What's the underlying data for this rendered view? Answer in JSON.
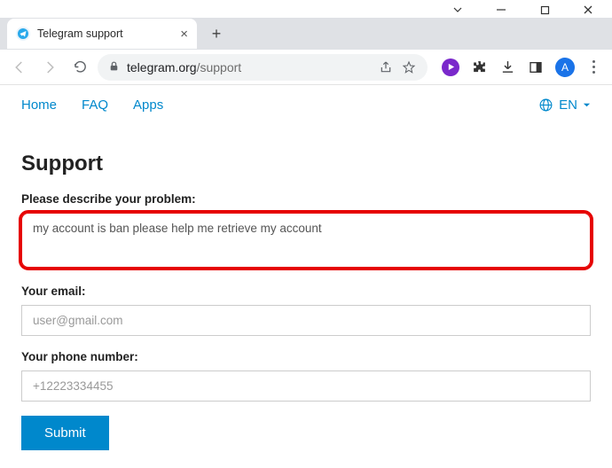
{
  "browser": {
    "tab_title": "Telegram support",
    "url_host": "telegram.org",
    "url_path": "/support",
    "avatar_letter": "A"
  },
  "nav": {
    "home": "Home",
    "faq": "FAQ",
    "apps": "Apps",
    "lang": "EN"
  },
  "page_title": "Support",
  "form": {
    "problem_label": "Please describe your problem:",
    "problem_value": "my account is ban please help me retrieve my account",
    "email_label": "Your email:",
    "email_placeholder": "user@gmail.com",
    "phone_label": "Your phone number:",
    "phone_placeholder": "+12223334455",
    "submit_label": "Submit"
  }
}
